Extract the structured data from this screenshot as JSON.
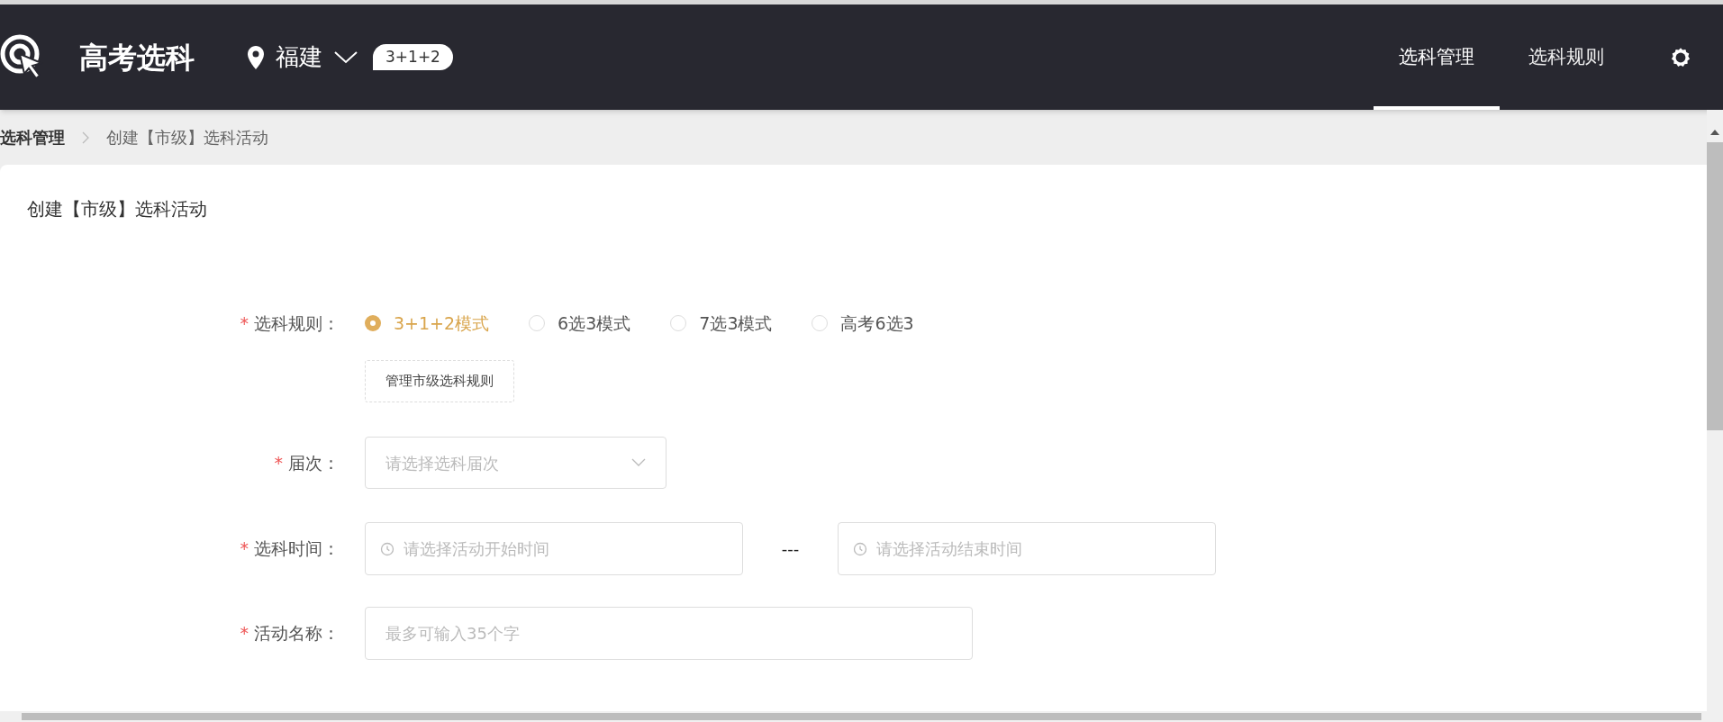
{
  "header": {
    "title": "高考选科",
    "location": "福建",
    "mode_badge": "3+1+2",
    "nav": [
      {
        "label": "选科管理",
        "selected": true
      },
      {
        "label": "选科规则",
        "selected": false
      }
    ]
  },
  "breadcrumb": [
    "选科管理",
    "创建【市级】选科活动"
  ],
  "card": {
    "title": "创建【市级】选科活动"
  },
  "form": {
    "rule": {
      "label": "选科规则：",
      "required_mark": "*",
      "options": [
        {
          "label": "3+1+2模式",
          "selected": true
        },
        {
          "label": "6选3模式",
          "selected": false
        },
        {
          "label": "7选3模式",
          "selected": false
        },
        {
          "label": "高考6选3",
          "selected": false
        }
      ],
      "manage_button": "管理市级选科规则"
    },
    "session": {
      "label": "届次：",
      "required_mark": "*",
      "placeholder": "请选择选科届次"
    },
    "time": {
      "label": "选科时间：",
      "required_mark": "*",
      "start_placeholder": "请选择活动开始时间",
      "separator": "---",
      "end_placeholder": "请选择活动结束时间"
    },
    "name": {
      "label": "活动名称：",
      "required_mark": "*",
      "placeholder": "最多可输入35个字"
    }
  }
}
